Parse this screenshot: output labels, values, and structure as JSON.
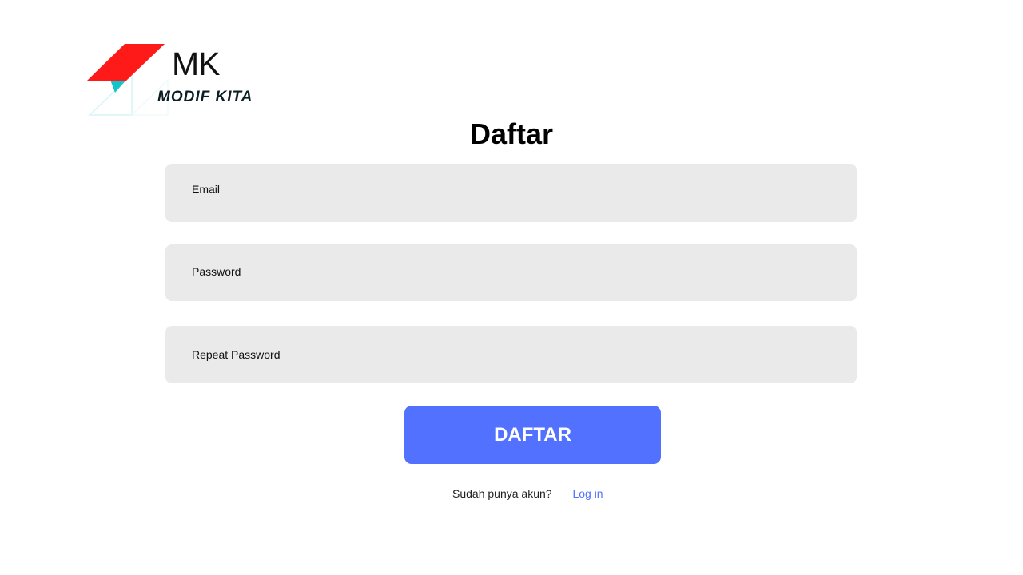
{
  "logo": {
    "mark": "MK",
    "name": "MODIF KITA",
    "colors": {
      "red": "#ff1a1a",
      "teal": "#12c4cc",
      "text": "#111111"
    }
  },
  "page_title": "Daftar",
  "form": {
    "email": {
      "placeholder": "Email",
      "value": ""
    },
    "password": {
      "placeholder": "Password",
      "value": ""
    },
    "repeat_password": {
      "placeholder": "Repeat Password",
      "value": ""
    },
    "submit_label": "DAFTAR"
  },
  "footer": {
    "question": "Sudah punya akun?",
    "login_link": "Log in"
  },
  "colors": {
    "accent": "#5271ff",
    "field_bg": "#eaeaea"
  }
}
